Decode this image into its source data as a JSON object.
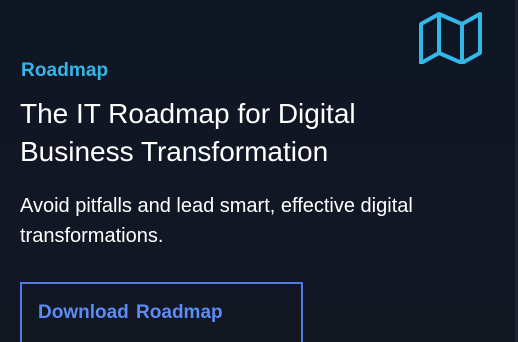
{
  "card": {
    "eyebrow": "Roadmap",
    "headline": "The IT Roadmap for Digital Business Transformation",
    "description": "Avoid pitfalls and lead smart, effective digital transformations.",
    "button_label": "Download Roadmap",
    "icon": "map-icon"
  },
  "colors": {
    "background": "#101522",
    "accent": "#35b6e8",
    "button": "#4f7de8"
  }
}
